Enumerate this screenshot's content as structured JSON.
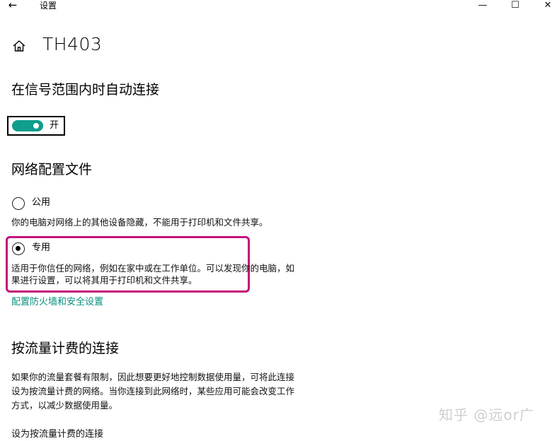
{
  "titlebar": {
    "back_glyph": "←",
    "title": "设置",
    "minimize_glyph": "—",
    "maximize_glyph": "☐",
    "close_glyph": "✕"
  },
  "header": {
    "network_name": "TH403"
  },
  "auto_connect": {
    "title": "在信号范围内时自动连接",
    "toggle_state": "开",
    "accent_color": "#0f9d8c"
  },
  "profile": {
    "title": "网络配置文件",
    "options": [
      {
        "label": "公用",
        "selected": false,
        "description_lines": [
          "你的电脑对网络上的其他设备隐藏，不能用于打印机和文件共享。"
        ]
      },
      {
        "label": "专用",
        "selected": true,
        "description_lines": [
          "适用于你信任的网络，例如在家中或在工作单位。可以发现你的电脑，如",
          "果进行设置，可以将其用于打印机和文件共享。"
        ]
      }
    ],
    "firewall_link": "配置防火墙和安全设置",
    "highlight_color": "#c4127a"
  },
  "metered": {
    "title": "按流量计费的连接",
    "description_lines": [
      "如果你的流量套餐有限制，因此想要更好地控制数据使用量，可将此连接",
      "设为按流量计费的网络。当你连接到此网络时，某些应用可能会改变工作",
      "方式，以减少数据使用量。"
    ],
    "setting_label": "设为按流量计费的连接"
  },
  "watermark": "知乎 @远or广"
}
